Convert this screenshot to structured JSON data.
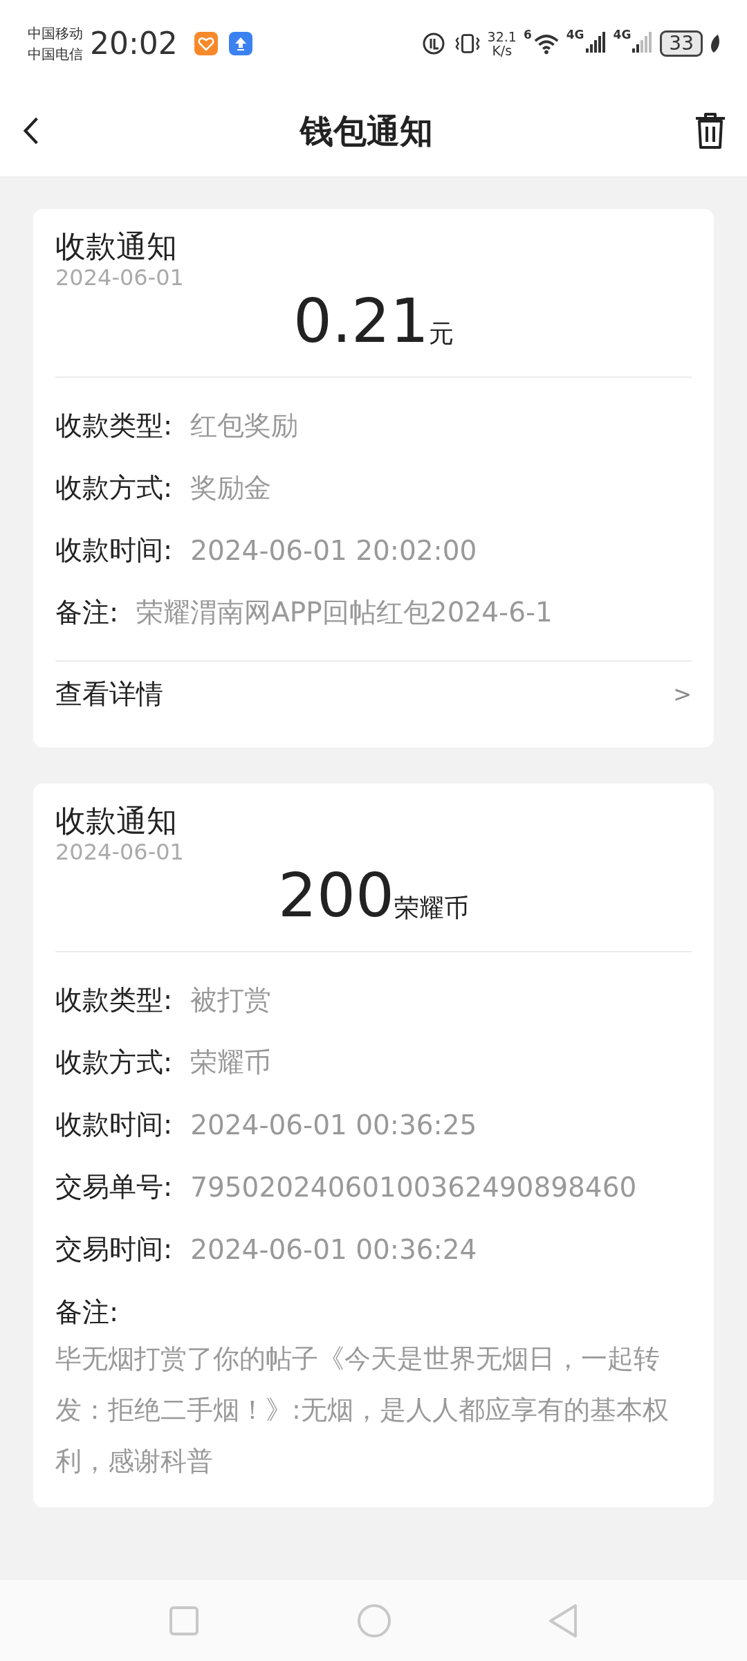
{
  "status_bar": {
    "carriers": [
      "中国移动",
      "中国电信"
    ],
    "time": "20:02",
    "speed_value": "32.1",
    "speed_unit": "K/s",
    "wifi_label": "6",
    "network_labels": [
      "4G",
      "4G"
    ],
    "battery": "33"
  },
  "header": {
    "title": "钱包通知"
  },
  "notifications": [
    {
      "title": "收款通知",
      "date": "2024-06-01",
      "amount": "0.21",
      "unit": "元",
      "rows": [
        {
          "kind": "inline",
          "label": "收款类型:",
          "value": "红包奖励"
        },
        {
          "kind": "inline",
          "label": "收款方式:",
          "value": "奖励金"
        },
        {
          "kind": "inline",
          "label": "收款时间:",
          "value": "2024-06-01 20:02:00"
        },
        {
          "kind": "inline",
          "label": "备注:",
          "value": "荣耀渭南网APP回帖红包2024-6-1"
        }
      ],
      "details_link": {
        "label": "查看详情",
        "chevron": ">"
      }
    },
    {
      "title": "收款通知",
      "date": "2024-06-01",
      "amount": "200",
      "unit": "荣耀币",
      "rows": [
        {
          "kind": "inline",
          "label": "收款类型:",
          "value": "被打赏"
        },
        {
          "kind": "inline",
          "label": "收款方式:",
          "value": "荣耀币"
        },
        {
          "kind": "inline",
          "label": "收款时间:",
          "value": "2024-06-01 00:36:25"
        },
        {
          "kind": "inline",
          "label": "交易单号:",
          "value": "79502024060100362490898460"
        },
        {
          "kind": "inline",
          "label": "交易时间:",
          "value": "2024-06-01 00:36:24"
        },
        {
          "kind": "block",
          "label": "备注:",
          "value": "毕无烟打赏了你的帖子《今天是世界无烟日，一起转发：拒绝二手烟！》:无烟，是人人都应享有的基本权利，感谢科普"
        }
      ]
    }
  ]
}
